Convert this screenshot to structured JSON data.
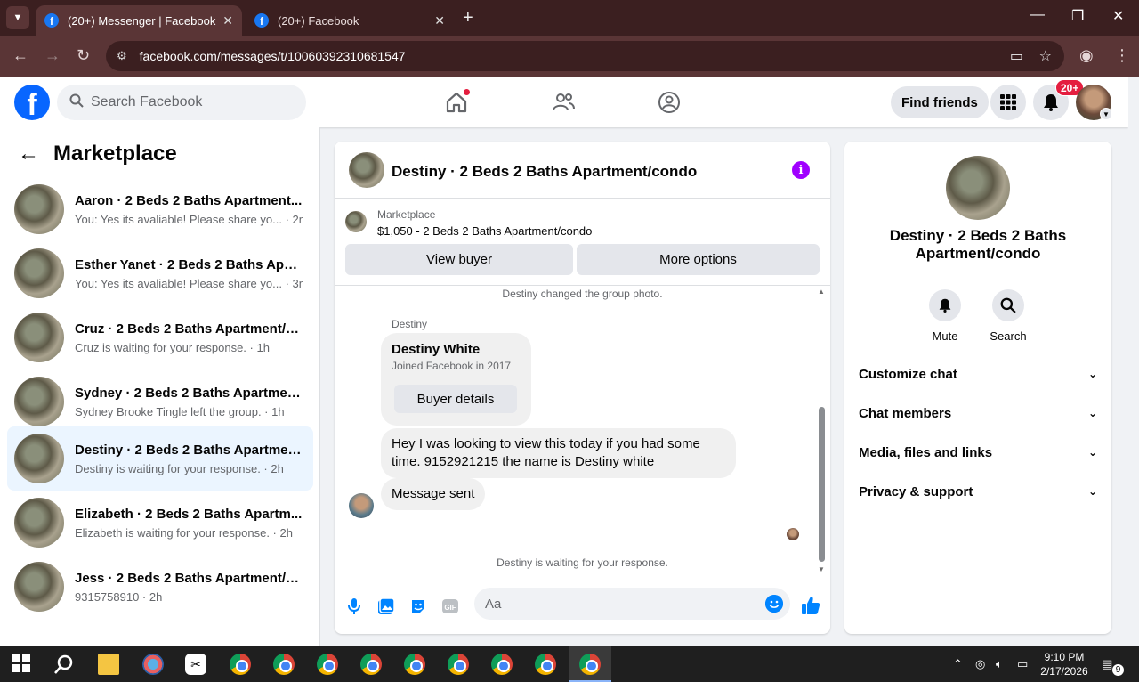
{
  "browser": {
    "tabs": [
      {
        "title": "(20+) Messenger | Facebook",
        "active": true
      },
      {
        "title": "(20+) Facebook",
        "active": false
      }
    ],
    "url": "facebook.com/messages/t/10060392310681547"
  },
  "fb": {
    "search_placeholder": "Search Facebook",
    "find_friends": "Find friends",
    "notif_badge": "20+"
  },
  "sidebar": {
    "title": "Marketplace",
    "conversations": [
      {
        "name": "Aaron · 2 Beds 2 Baths Apartment...",
        "snippet": "You: Yes its avaliable! Please share yo... · 2m"
      },
      {
        "name": "Esther Yanet · 2 Beds 2 Baths Apar...",
        "snippet": "You: Yes its avaliable! Please share yo... · 3m"
      },
      {
        "name": "Cruz · 2 Beds 2 Baths Apartment/c...",
        "snippet": "Cruz is waiting for your response. · 1h"
      },
      {
        "name": "Sydney · 2 Beds 2 Baths Apartmen...",
        "snippet": "Sydney Brooke Tingle left the group. · 1h"
      },
      {
        "name": "Destiny · 2 Beds 2 Baths Apartmen...",
        "snippet": "Destiny is waiting for your response. · 2h"
      },
      {
        "name": "Elizabeth · 2 Beds 2 Baths Apartm...",
        "snippet": "Elizabeth is waiting for your response. · 2h"
      },
      {
        "name": "Jess · 2 Beds 2 Baths Apartment/c...",
        "snippet": "9315758910 · 2h"
      }
    ]
  },
  "chat": {
    "title": "Destiny · 2 Beds 2 Baths Apartment/condo",
    "marketplace_label": "Marketplace",
    "listing": "$1,050 - 2 Beds 2 Baths Apartment/condo",
    "view_buyer": "View buyer",
    "more_options": "More options",
    "system_top": "Destiny changed the group photo.",
    "sender": "Destiny",
    "card_name": "Destiny White",
    "card_joined": "Joined Facebook in 2017",
    "buyer_details": "Buyer details",
    "message": "Hey I was looking to view this today if you had some time. 9152921215 the name is Destiny white",
    "message_sent": "Message sent",
    "system_bottom": "Destiny is waiting for your response.",
    "composer_placeholder": "Aa"
  },
  "right_panel": {
    "name": "Destiny · 2 Beds 2 Baths Apartment/condo",
    "mute": "Mute",
    "search": "Search",
    "sections": [
      "Customize chat",
      "Chat members",
      "Media, files and links",
      "Privacy & support"
    ]
  },
  "taskbar": {
    "time": "9:10 PM",
    "date": "2/17/2026",
    "notif_count": "9"
  },
  "colors": {
    "fb_blue": "#0866ff",
    "messenger_blue": "#0084ff",
    "badge_red": "#e41e3f",
    "info_purple": "#a000ff",
    "browser_frame": "#3b1f20"
  }
}
